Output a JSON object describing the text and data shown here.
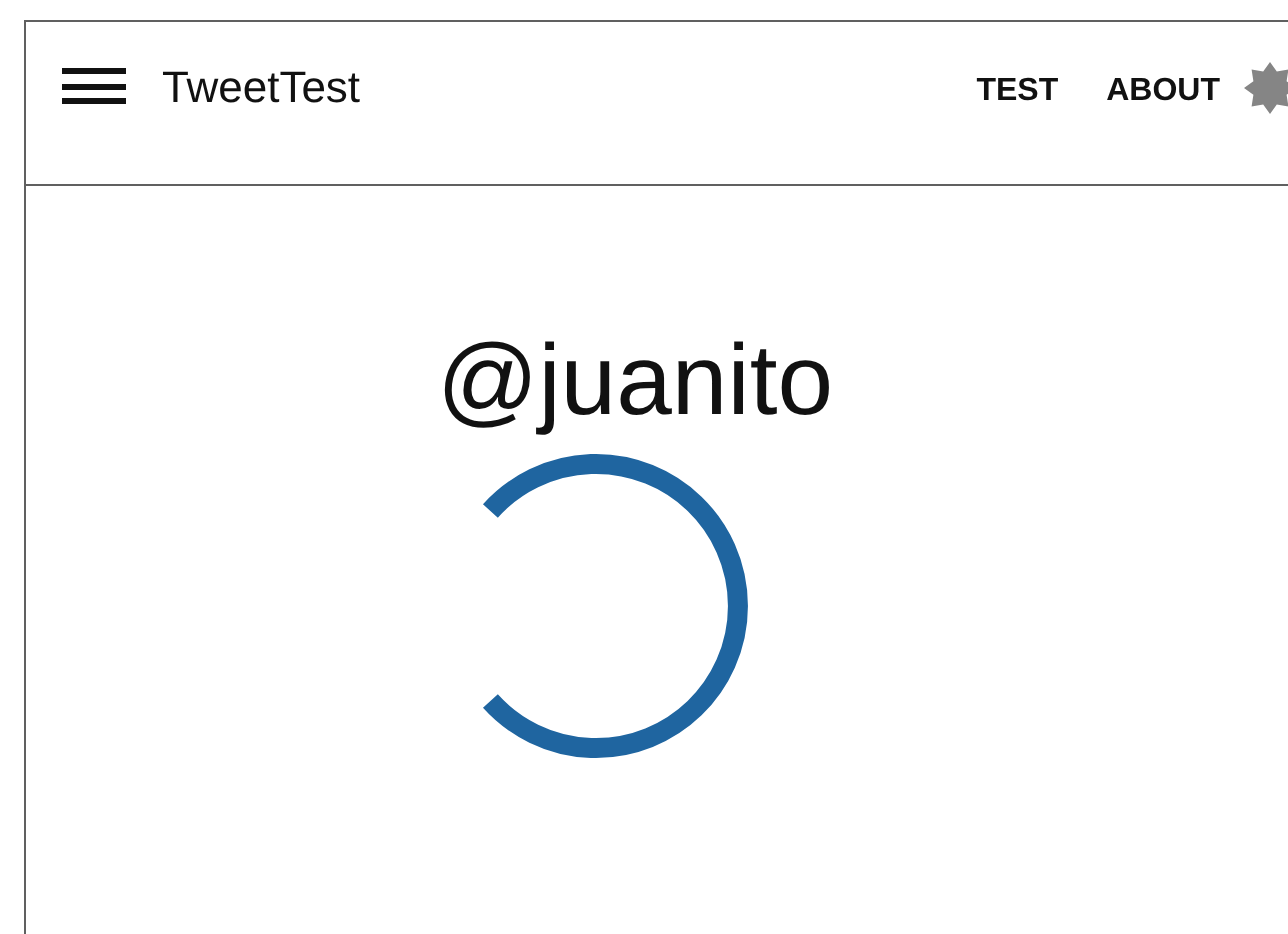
{
  "app_bar": {
    "title": "TweetTest",
    "nav": [
      {
        "label": "TEST"
      },
      {
        "label": "ABOUT"
      }
    ]
  },
  "profile": {
    "handle": "@juanito"
  }
}
